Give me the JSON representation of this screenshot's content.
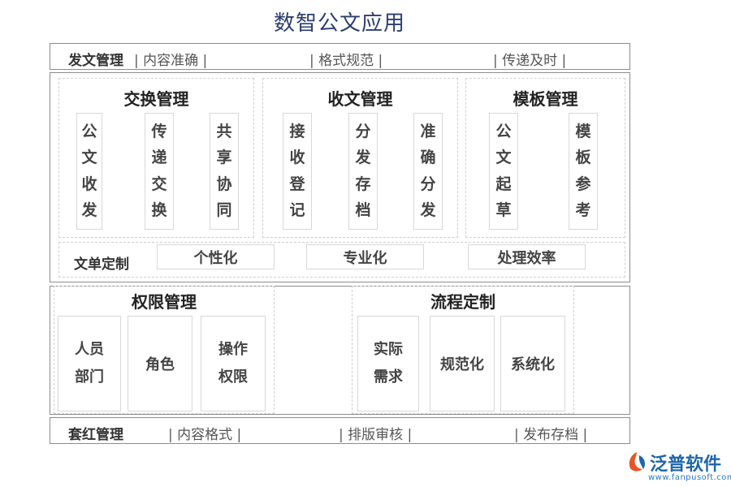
{
  "title": "数智公文应用",
  "row_top": {
    "label": "发文管理",
    "item1": "| 内容准确 |",
    "item2": "| 格式规范 |",
    "item3": "| 传递及时 |"
  },
  "exchange": {
    "title": "交换管理",
    "col1": [
      "公",
      "文",
      "收",
      "发"
    ],
    "col2": [
      "传",
      "递",
      "交",
      "换"
    ],
    "col3": [
      "共",
      "享",
      "协",
      "同"
    ]
  },
  "receive": {
    "title": "收文管理",
    "col1": [
      "接",
      "收",
      "登",
      "记"
    ],
    "col2": [
      "分",
      "发",
      "存",
      "档"
    ],
    "col3": [
      "准",
      "确",
      "分",
      "发"
    ]
  },
  "template": {
    "title": "模板管理",
    "col1": [
      "公",
      "文",
      "起",
      "草"
    ],
    "col2": [
      "模",
      "板",
      "参",
      "考"
    ]
  },
  "custom_row": {
    "label": "文单定制",
    "item1": "个性化",
    "item2": "专业化",
    "item3": "处理效率"
  },
  "permission": {
    "title": "权限管理",
    "c1_line1": "人员",
    "c1_line2": "部门",
    "c2": "角色",
    "c3_line1": "操作",
    "c3_line2": "权限"
  },
  "process": {
    "title": "流程定制",
    "c1_line1": "实际",
    "c1_line2": "需求",
    "c2": "规范化",
    "c3": "系统化"
  },
  "row_bottom": {
    "label": "套红管理",
    "item1": "| 内容格式 |",
    "item2": "| 排版审核 |",
    "item3": "| 发布存档 |"
  },
  "logo": {
    "name": "泛普软件",
    "url": "www.fanpusoft.com",
    "icon": "fanpu-logo-icon",
    "color": "#1e66a8"
  }
}
